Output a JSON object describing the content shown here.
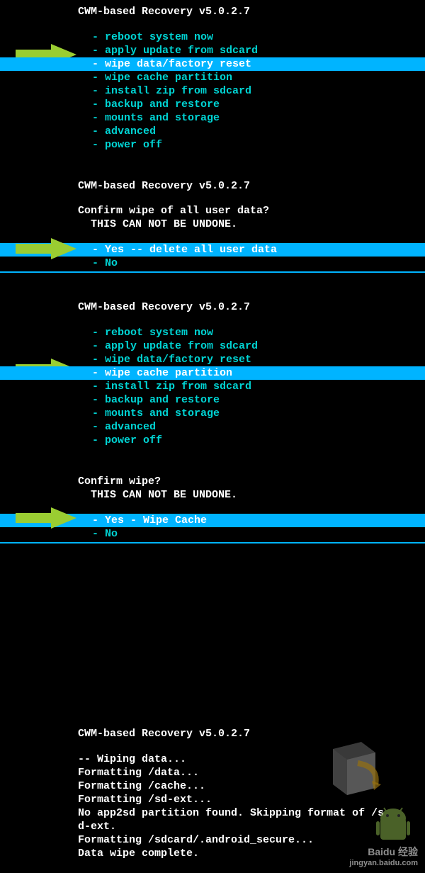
{
  "header": "CWM-based Recovery v5.0.2.7",
  "menu": {
    "items": [
      {
        "label": "reboot system now"
      },
      {
        "label": "apply update from sdcard"
      },
      {
        "label": "wipe data/factory reset"
      },
      {
        "label": "wipe cache partition"
      },
      {
        "label": "install zip from sdcard"
      },
      {
        "label": "backup and restore"
      },
      {
        "label": "mounts and storage"
      },
      {
        "label": "advanced"
      },
      {
        "label": "power off"
      }
    ]
  },
  "confirm1": {
    "question": "Confirm wipe of all user data?",
    "warning": "THIS CAN NOT BE UNDONE.",
    "yes": " Yes -- delete all user data",
    "no": " No"
  },
  "confirm2": {
    "question": "Confirm wipe?",
    "warning": "THIS CAN NOT BE UNDONE.",
    "yes": "Yes - Wipe Cache",
    "no": "No"
  },
  "log": {
    "lines": [
      "-- Wiping data...",
      "Formatting /data...",
      "Formatting /cache...",
      "Formatting /sd-ext...",
      "No app2sd partition found. Skipping format of /s",
      "d-ext.",
      "Formatting /sdcard/.android_secure...",
      "Data wipe complete."
    ]
  },
  "watermark": {
    "brand": "Baidu 经验",
    "url": "jingyan.baidu.com"
  }
}
